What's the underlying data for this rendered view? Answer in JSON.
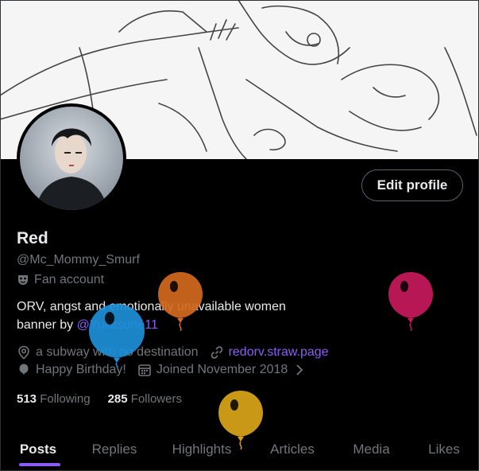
{
  "profile": {
    "name": "Red",
    "handle": "@Mc_Mommy_Smurf",
    "category": "Fan account",
    "bio_line1": "ORV, angst and emotionally unavailable women",
    "bio_line2_prefix": "banner by ",
    "bio_mention": "@Yukitsune11",
    "location": "a subway with no destination",
    "website": "redorv.straw.page",
    "birthday": "Happy Birthday!",
    "joined": "Joined November 2018",
    "following_count": "513",
    "following_label": "Following",
    "followers_count": "285",
    "followers_label": "Followers"
  },
  "actions": {
    "edit_profile": "Edit profile"
  },
  "tabs": [
    {
      "label": "Posts",
      "active": true
    },
    {
      "label": "Replies",
      "active": false
    },
    {
      "label": "Highlights",
      "active": false
    },
    {
      "label": "Articles",
      "active": false
    },
    {
      "label": "Media",
      "active": false
    },
    {
      "label": "Likes",
      "active": false
    }
  ],
  "colors": {
    "accent": "#8b5cf6",
    "background": "#000000",
    "text": "#e7e9ea",
    "muted": "#71767b",
    "balloon_orange": "#d2691e",
    "balloon_blue": "#1d8fd8",
    "balloon_magenta": "#c2185b",
    "balloon_gold": "#d4a017"
  },
  "icons": {
    "category": "mask-icon",
    "location": "location-pin-icon",
    "website": "link-icon",
    "birthday": "balloon-icon",
    "joined": "calendar-icon",
    "joined_more": "chevron-right-icon"
  }
}
